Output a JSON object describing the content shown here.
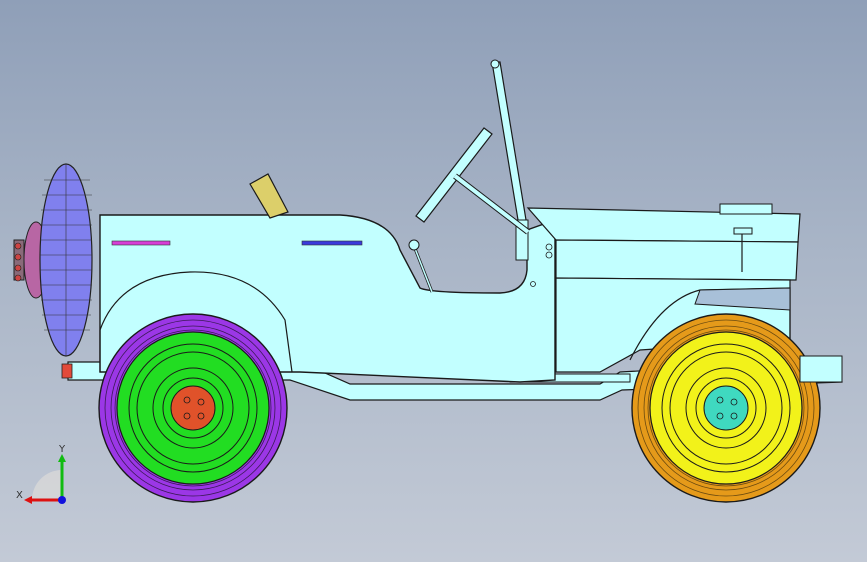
{
  "viewport": {
    "background_top": "#8f9fb8",
    "background_bottom": "#c3cad6"
  },
  "model": {
    "body_color": "#c2ffff",
    "outline_color": "#1a1a1a",
    "rear_tire_color": "#9b37e6",
    "rear_rim_color": "#22dd22",
    "rear_hub_color": "#e0522a",
    "front_tire_color": "#e59a1a",
    "front_rim_color": "#f2f21a",
    "front_hub_color": "#3fd9c0",
    "spare_tire_color": "#8080ee",
    "spare_hub_color": "#b866a4",
    "gear_lever_color": "#dccf6a"
  },
  "triad": {
    "x_label": "X",
    "y_label": "Y",
    "x_color": "#dd1111",
    "y_color": "#11bb11",
    "z_color": "#1111dd"
  }
}
